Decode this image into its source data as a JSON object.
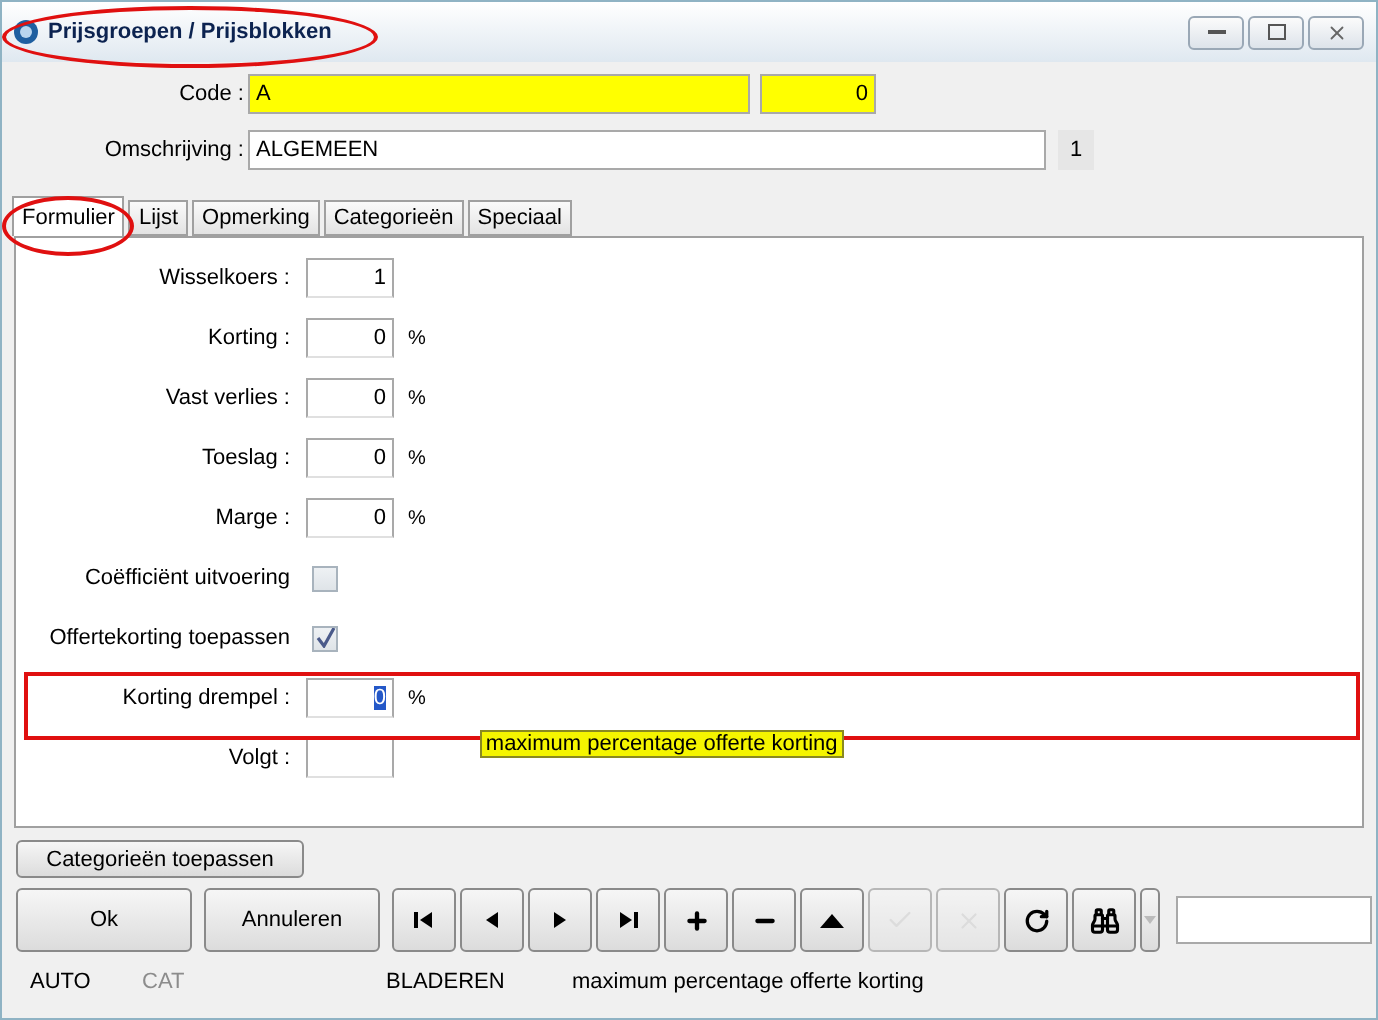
{
  "window": {
    "title": "Prijsgroepen / Prijsblokken"
  },
  "header": {
    "code_label": "Code :",
    "code_value": "A",
    "code_number": "0",
    "description_label": "Omschrijving :",
    "description_value": "ALGEMEEN",
    "description_count": "1"
  },
  "tabs": [
    {
      "label": "Formulier",
      "selected": true
    },
    {
      "label": "Lijst",
      "selected": false
    },
    {
      "label": "Opmerking",
      "selected": false
    },
    {
      "label": "Categorieën",
      "selected": false
    },
    {
      "label": "Speciaal",
      "selected": false
    }
  ],
  "fields": [
    {
      "kind": "number",
      "label": "Wisselkoers :",
      "value": "1"
    },
    {
      "kind": "number",
      "label": "Korting :",
      "value": "0",
      "unit": "%"
    },
    {
      "kind": "number",
      "label": "Vast verlies :",
      "value": "0",
      "unit": "%"
    },
    {
      "kind": "number",
      "label": "Toeslag :",
      "value": "0",
      "unit": "%"
    },
    {
      "kind": "number",
      "label": "Marge :",
      "value": "0",
      "unit": "%"
    },
    {
      "kind": "checkbox",
      "label": "Coëfficiënt uitvoering",
      "checked": false
    },
    {
      "kind": "checkbox",
      "label": "Offertekorting toepassen",
      "checked": true
    },
    {
      "kind": "number",
      "label": "Korting drempel :",
      "value": "0",
      "unit": "%",
      "focused": true,
      "tooltip": "maximum percentage offerte korting"
    },
    {
      "kind": "number",
      "label": "Volgt :"
    }
  ],
  "apply_button": "Categorieën toepassen",
  "buttons": [
    {
      "label": "Ok"
    },
    {
      "label": "Annuleren"
    }
  ],
  "toolbar": [
    {
      "kind": "first",
      "disabled": false
    },
    {
      "kind": "prev",
      "disabled": false
    },
    {
      "kind": "next",
      "disabled": false
    },
    {
      "kind": "last",
      "disabled": false
    },
    {
      "kind": "add",
      "disabled": false
    },
    {
      "kind": "remove",
      "disabled": false
    },
    {
      "kind": "up",
      "disabled": false
    },
    {
      "kind": "confirm",
      "disabled": true
    },
    {
      "kind": "cancel",
      "disabled": true
    },
    {
      "kind": "refresh",
      "disabled": false
    },
    {
      "kind": "find",
      "disabled": false
    }
  ],
  "status_bar": [
    {
      "text": "AUTO",
      "disabled": false
    },
    {
      "text": "CAT",
      "disabled": true
    },
    {
      "text": "BLADEREN",
      "disabled": false
    },
    {
      "text": "maximum percentage offerte korting",
      "disabled": false
    }
  ]
}
